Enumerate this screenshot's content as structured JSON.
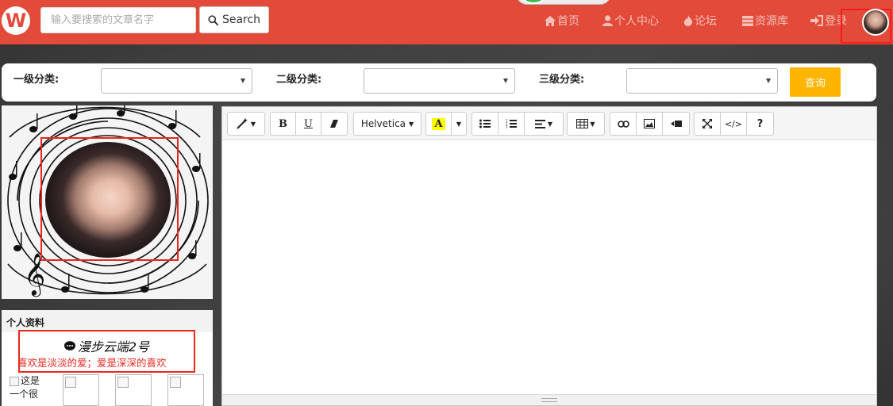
{
  "nav": {
    "search_placeholder": "输入要搜索的文章名字",
    "search_button": "Search",
    "items": [
      {
        "label": "首页",
        "icon": "home-icon"
      },
      {
        "label": "个人中心",
        "icon": "user-icon"
      },
      {
        "label": "论坛",
        "icon": "fire-icon"
      },
      {
        "label": "资源库",
        "icon": "database-icon"
      },
      {
        "label": "登录",
        "icon": "login-icon"
      }
    ]
  },
  "categories": {
    "level1_label": "一级分类:",
    "level2_label": "二级分类:",
    "level3_label": "三级分类:",
    "query_button": "查询"
  },
  "profile": {
    "header": "个人资料",
    "name": "漫步云端2号",
    "bio": "喜欢是淡淡的爱；爱是深深的喜欢",
    "thumb_alt_line1": "这是",
    "thumb_alt_line2": "一个很"
  },
  "editor": {
    "font_name": "Helvetica",
    "bold": "B",
    "underline": "U",
    "code": "</>",
    "help": "?"
  },
  "colors": {
    "brand_red": "#e24a3a",
    "query_orange": "#ffb400",
    "highlight_red": "#e8281e"
  }
}
